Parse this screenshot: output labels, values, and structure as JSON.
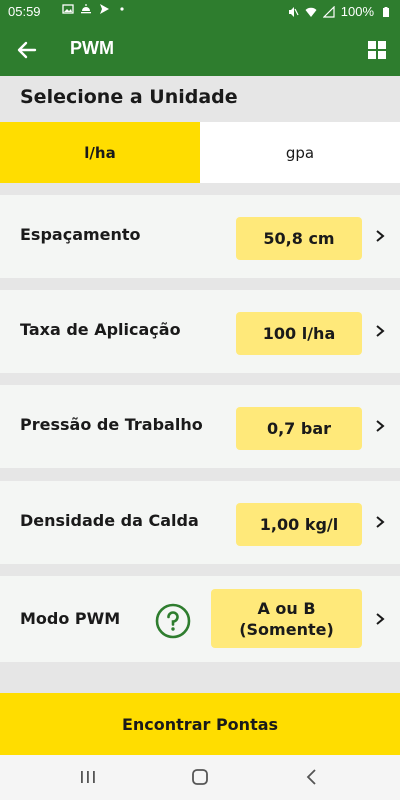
{
  "status_bar": {
    "time": "05:59",
    "battery": "100%",
    "icons_left": [
      "image-icon",
      "weather-icon",
      "send-icon",
      "dot-icon"
    ],
    "icons_right": [
      "mute-icon",
      "wifi-icon",
      "signal-icon",
      "battery-icon"
    ]
  },
  "app_bar": {
    "title": "PWM",
    "background": "#2e7d2e",
    "back_icon": "arrow-left-icon",
    "menu_icon": "grid-icon"
  },
  "unit_section": {
    "heading": "Selecione a Unidade",
    "tabs": [
      {
        "label": "l/ha",
        "active": true
      },
      {
        "label": "gpa",
        "active": false
      }
    ],
    "accent": "#ffdd00"
  },
  "settings": [
    {
      "label": "Espaçamento",
      "value": "50,8 cm"
    },
    {
      "label": "Taxa de Aplicação",
      "value": "100 l/ha"
    },
    {
      "label": "Pressão de Trabalho",
      "value": "0,7 bar"
    },
    {
      "label": "Densidade da Calda",
      "value": "1,00 kg/l"
    }
  ],
  "pwm_mode": {
    "label": "Modo PWM",
    "value_line1": "A ou B",
    "value_line2": "(Somente)",
    "help_icon": "question-circle-icon"
  },
  "action": {
    "find_label": "Encontrar Pontas"
  },
  "nav_bar": {
    "icons": [
      "recents-icon",
      "home-icon",
      "back-icon"
    ]
  }
}
